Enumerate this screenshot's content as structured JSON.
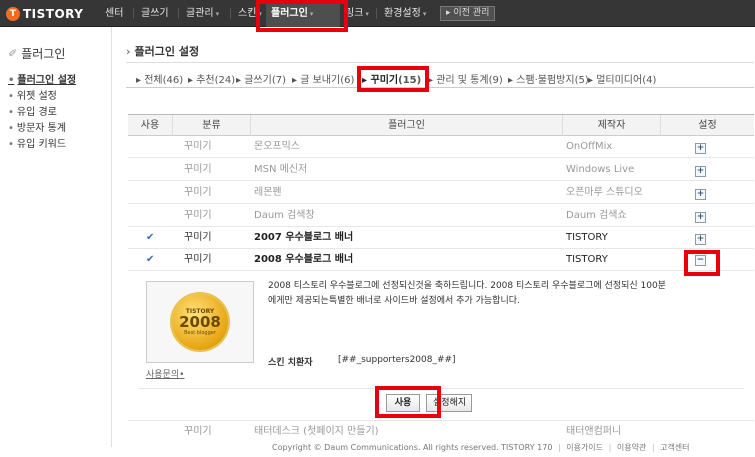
{
  "topnav": {
    "logo": "TISTORY",
    "logo_mark": "T",
    "items": [
      "센터",
      "글쓰기",
      "글관리",
      "스킨",
      "플러그인",
      "링크",
      "환경설정"
    ],
    "old_admin": "이전 관리",
    "old_admin_arrow": "▸"
  },
  "sidebar": {
    "title": "플러그인",
    "items": [
      "플러그인 설정",
      "위젯 설정",
      "유입 경로",
      "방문자 통계",
      "유입 키워드"
    ]
  },
  "main": {
    "title": "플러그인 설정",
    "filters": [
      {
        "label": "전체",
        "count": "(46)"
      },
      {
        "label": "추천",
        "count": "(24)"
      },
      {
        "label": "글쓰기",
        "count": "(7)"
      },
      {
        "label": "글 보내기",
        "count": "(6)"
      },
      {
        "label": "꾸미기",
        "count": "(15)"
      },
      {
        "label": "관리 및 통계",
        "count": "(9)"
      },
      {
        "label": "스팸·불펌방지",
        "count": "(5)"
      },
      {
        "label": "멀티미디어",
        "count": "(4)"
      }
    ]
  },
  "table": {
    "headers": [
      "사용",
      "분류",
      "플러그인",
      "제작자",
      "설정"
    ],
    "rows": [
      {
        "used": "",
        "category": "꾸미기",
        "name": "몬오프믹스",
        "maker": "OnOffMix",
        "toggle": "+"
      },
      {
        "used": "",
        "category": "꾸미기",
        "name": "MSN 메신저",
        "maker": "Windows Live",
        "toggle": "+"
      },
      {
        "used": "",
        "category": "꾸미기",
        "name": "레몬펜",
        "maker": "오픈마루 스튜디오",
        "toggle": "+"
      },
      {
        "used": "",
        "category": "꾸미기",
        "name": "Daum 검색창",
        "maker": "Daum 검색쇼",
        "toggle": "+"
      },
      {
        "used": "✔",
        "category": "꾸미기",
        "name": "2007 우수블로그 배너",
        "maker": "TISTORY",
        "toggle": "+"
      },
      {
        "used": "✔",
        "category": "꾸미기",
        "name": "2008 우수블로그 배너",
        "maker": "TISTORY",
        "toggle": "−"
      },
      {
        "used": "",
        "category": "꾸미기",
        "name": "태터데스크 (첫페이지 만들기)",
        "maker": "태터앤컴퍼니",
        "toggle": ""
      }
    ],
    "detail": {
      "description": "2008 티스토리 우수블로그에 선정되신것을 축하드립니다. 2008 티스토리 우수블로그에 선정되신 100분 에게만 제공되는특별한 배너로 사이드바 설정에서 추가 가능합니다.",
      "badge_top": "TISTORY",
      "badge_year": "2008",
      "badge_sub": "Best blogger",
      "skin_label": "스킨 치환자",
      "skin_value": "[##_supporters2008_##]",
      "support_link": "사용문의",
      "support_link_suffix": "•",
      "use_button": "사용",
      "unset_button": "설정해지"
    }
  },
  "footer": {
    "copyright": "Copyright © Daum Communications. All rights reserved. TISTORY 170",
    "links": [
      "이용가이드",
      "이용약관",
      "고객센터"
    ]
  }
}
